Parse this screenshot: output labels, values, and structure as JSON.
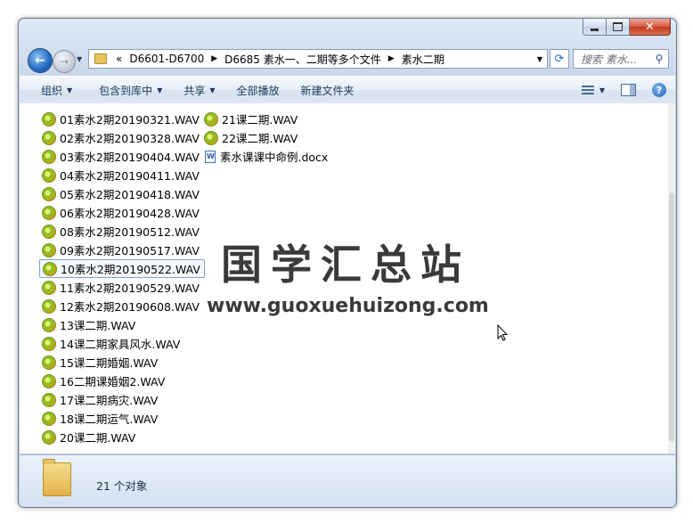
{
  "window": {
    "close_glyph": "✕"
  },
  "nav": {
    "back_glyph": "←",
    "fwd_glyph": "→",
    "breadcrumb_prefix": "«",
    "breadcrumb": [
      "D6601-D6700",
      "D6685 素水一、二期等多个文件",
      "素水二期"
    ],
    "search_placeholder": "搜索 素水..."
  },
  "toolbar": {
    "organize": "组织",
    "include_library": "包含到库中",
    "share": "共享",
    "play_all": "全部播放",
    "new_folder": "新建文件夹"
  },
  "files": {
    "column1": [
      "01素水2期20190321.WAV",
      "02素水2期20190328.WAV",
      "03素水2期20190404.WAV",
      "04素水2期20190411.WAV",
      "05素水2期20190418.WAV",
      "06素水2期20190428.WAV",
      "08素水2期20190512.WAV",
      "09素水2期20190517.WAV",
      "10素水2期20190522.WAV",
      "11素水2期20190529.WAV",
      "12素水2期20190608.WAV",
      "13课二期.WAV",
      "14课二期家具风水.WAV",
      "15课二期婚姻.WAV",
      "16二期课婚姻2.WAV",
      "17课二期病灾.WAV",
      "18课二期运气.WAV",
      "20课二期.WAV"
    ],
    "column2": [
      "21课二期.WAV",
      "22课二期.WAV",
      "素水课课中命例.docx"
    ],
    "selected_index": 8
  },
  "watermark": {
    "title": "国学汇总站",
    "url": "www.guoxuehuizong.com"
  },
  "details": {
    "count_text": "21 个对象"
  },
  "colors": {
    "accent": "#2a6db8",
    "selection_border": "#7da2ce",
    "close_button": "#c3391b"
  }
}
